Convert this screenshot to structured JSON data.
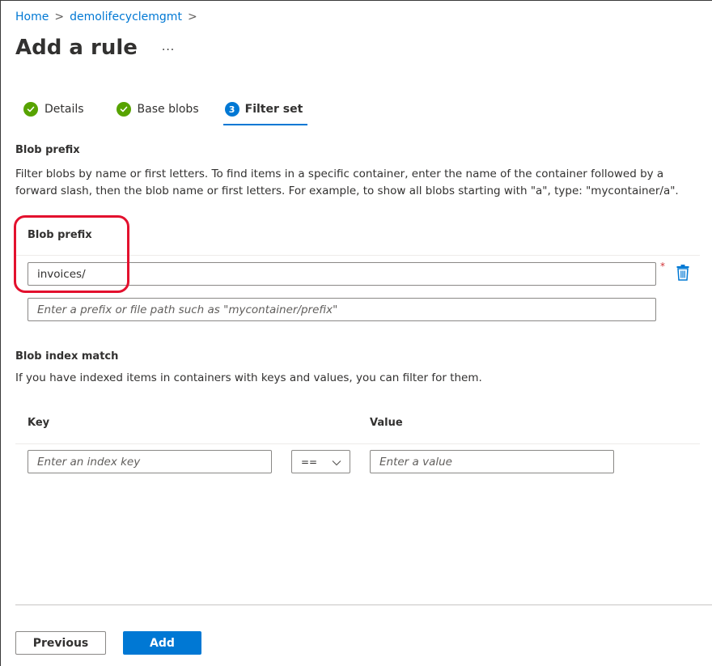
{
  "breadcrumb": {
    "items": [
      "Home",
      "demolifecyclemgmt"
    ],
    "separator": ">"
  },
  "page": {
    "title": "Add a rule",
    "more_icon": "ellipsis-icon",
    "more_label": "···"
  },
  "tabs": [
    {
      "label": "Details",
      "status": "complete",
      "icon": "check-circle-icon"
    },
    {
      "label": "Base blobs",
      "status": "complete",
      "icon": "check-circle-icon"
    },
    {
      "label": "Filter set",
      "status": "active",
      "number": "3"
    }
  ],
  "blob_prefix": {
    "heading": "Blob prefix",
    "description": "Filter blobs by name or first letters. To find items in a specific container, enter the name of the container followed by a forward slash, then the blob name or first letters. For example, to show all blobs starting with \"a\", type: \"mycontainer/a\".",
    "field_label": "Blob prefix",
    "value": "invoices/",
    "required_mark": "*",
    "delete_icon": "trash-icon",
    "new_placeholder": "Enter a prefix or file path such as \"mycontainer/prefix\""
  },
  "blob_index": {
    "heading": "Blob index match",
    "description": "If you have indexed items in containers with keys and values, you can filter for them.",
    "key_label": "Key",
    "value_label": "Value",
    "key_placeholder": "Enter an index key",
    "operator": "==",
    "value_placeholder": "Enter a value"
  },
  "footer": {
    "previous_label": "Previous",
    "add_label": "Add"
  },
  "colors": {
    "accent": "#0078d4",
    "success": "#57a300",
    "highlight": "#e3112e",
    "required": "#d13438"
  }
}
